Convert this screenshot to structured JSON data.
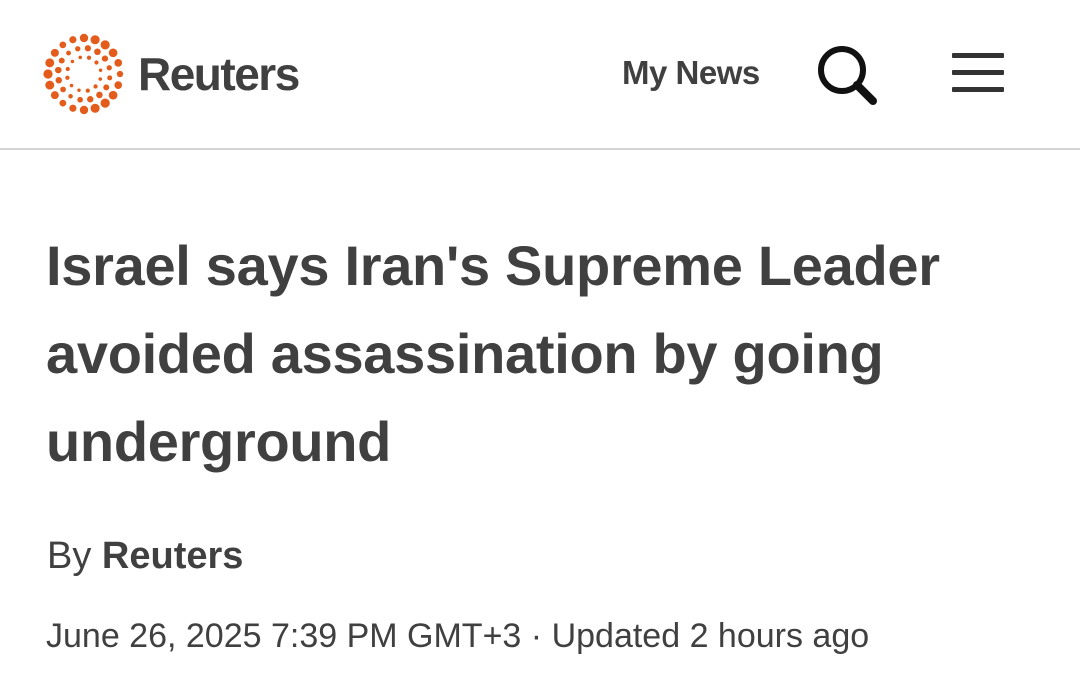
{
  "header": {
    "brand_name": "Reuters",
    "my_news_label": "My News",
    "icons": {
      "logo": "reuters-dot-ring-logo",
      "search": "search-icon",
      "menu": "hamburger-menu-icon"
    },
    "colors": {
      "logo_orange": "#e35c1c",
      "text": "#404040",
      "divider": "#d4d4d4"
    }
  },
  "article": {
    "headline": "Israel says Iran's Supreme Leader avoided assassination by going underground",
    "byline_prefix": "By",
    "author": "Reuters",
    "date": "June 26, 2025 7:39 PM GMT+3",
    "separator": "·",
    "updated": "Updated 2 hours ago"
  }
}
